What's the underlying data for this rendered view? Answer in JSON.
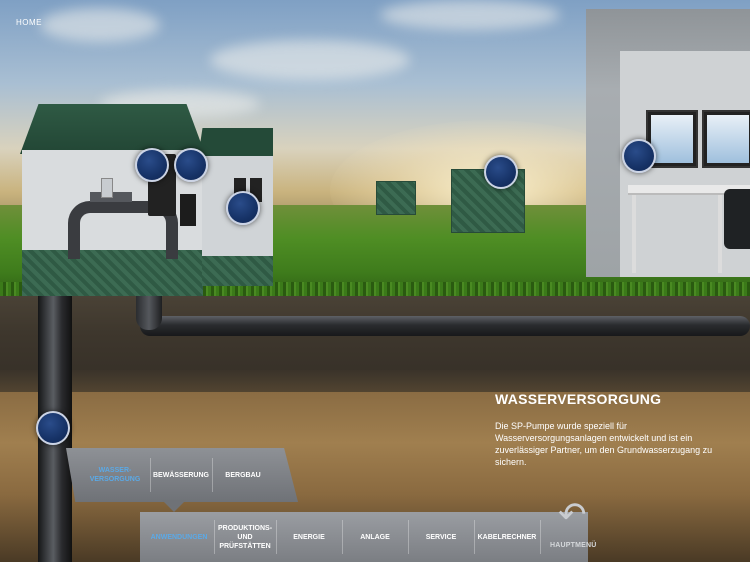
{
  "nav": {
    "home_label": "HOME"
  },
  "info": {
    "title": "WASSERVERSORGUNG",
    "lines": [
      "Die SP-Pumpe wurde speziell für",
      "Wasserversorgungsanlagen entwickelt und ist ein",
      "zuverlässiger Partner, um den Grundwasserzugang zu",
      "sichern."
    ]
  },
  "submenu": {
    "items": [
      {
        "label_line1": "WASSER-",
        "label_line2": "VERSORGUNG",
        "active": true
      },
      {
        "label_line1": "BEWÄSSERUNG",
        "label_line2": "",
        "active": false
      },
      {
        "label_line1": "BERGBAU",
        "label_line2": "",
        "active": false
      }
    ]
  },
  "main_menu": {
    "items": [
      {
        "label_line1": "ANWENDUNGEN",
        "label_line2": "",
        "label_line3": "",
        "active": true
      },
      {
        "label_line1": "PRODUKTIONS-",
        "label_line2": "UND",
        "label_line3": "PRÜFSTÄTTEN",
        "active": false
      },
      {
        "label_line1": "ENERGIE",
        "label_line2": "",
        "label_line3": "",
        "active": false
      },
      {
        "label_line1": "ANLAGE",
        "label_line2": "",
        "label_line3": "",
        "active": false
      },
      {
        "label_line1": "SERVICE",
        "label_line2": "",
        "label_line3": "",
        "active": false
      },
      {
        "label_line1": "KABELRECHNER",
        "label_line2": "",
        "label_line3": "",
        "active": false
      }
    ],
    "home_label": "HAUPTMENÜ"
  },
  "colors": {
    "accent": "#5ba9e6",
    "hotspot": "#163266"
  }
}
